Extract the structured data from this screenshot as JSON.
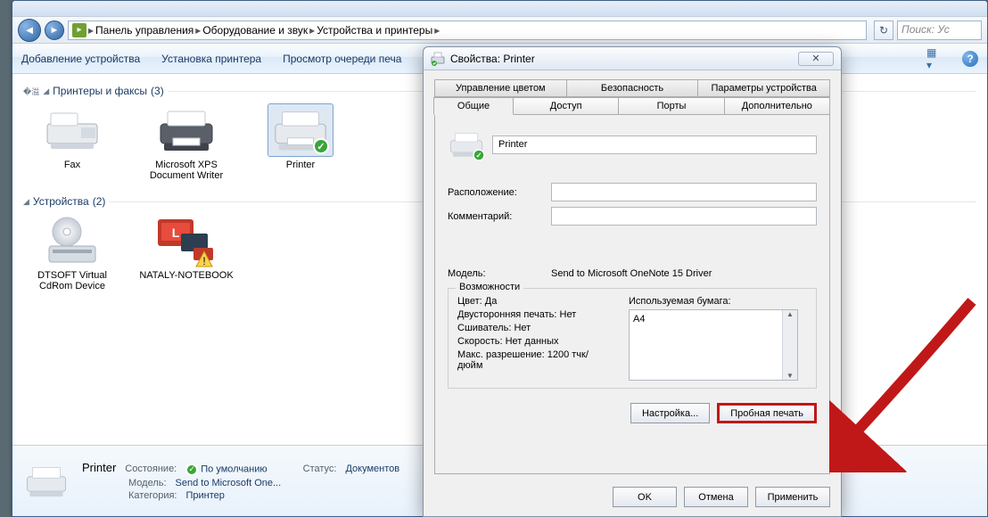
{
  "breadcrumb": {
    "seg1": "Панель управления",
    "seg2": "Оборудование и звук",
    "seg3": "Устройства и принтеры"
  },
  "search_placeholder": "Поиск: Ус",
  "toolbar": {
    "add_device": "Добавление устройства",
    "install_printer": "Установка принтера",
    "view_queue": "Просмотр очереди печа"
  },
  "groups": {
    "printers": {
      "title": "Принтеры и факсы",
      "count": "(3)"
    },
    "devices": {
      "title": "Устройства",
      "count": "(2)"
    }
  },
  "items": {
    "fax": "Fax",
    "xps": "Microsoft XPS Document Writer",
    "printer": "Printer",
    "cd": "DTSOFT Virtual CdRom Device",
    "note": "NATALY-NOTEBOOK"
  },
  "details": {
    "name": "Printer",
    "k_state": "Состояние:",
    "v_state": "По умолчанию",
    "k_status": "Статус:",
    "v_status": "Документов",
    "k_model": "Модель:",
    "v_model": "Send to Microsoft One...",
    "k_cat": "Категория:",
    "v_cat": "Принтер"
  },
  "dlg": {
    "title": "Свойства: Printer",
    "tabs": {
      "color": "Управление цветом",
      "security": "Безопасность",
      "device": "Параметры устройства",
      "general": "Общие",
      "sharing": "Доступ",
      "ports": "Порты",
      "advanced": "Дополнительно"
    },
    "name_value": "Printer",
    "k_location": "Расположение:",
    "k_comment": "Комментарий:",
    "k_model": "Модель:",
    "v_model": "Send to Microsoft OneNote 15 Driver",
    "grp_caps": "Возможности",
    "caps": {
      "color": "Цвет: Да",
      "duplex": "Двусторонняя печать: Нет",
      "staple": "Сшиватель: Нет",
      "speed": "Скорость: Нет данных",
      "maxres": "Макс. разрешение: 1200 тчк/дюйм",
      "paper_label": "Используемая бумага:",
      "paper_value": "A4"
    },
    "btn_prefs": "Настройка...",
    "btn_test": "Пробная печать",
    "btn_ok": "OK",
    "btn_cancel": "Отмена",
    "btn_apply": "Применить"
  }
}
